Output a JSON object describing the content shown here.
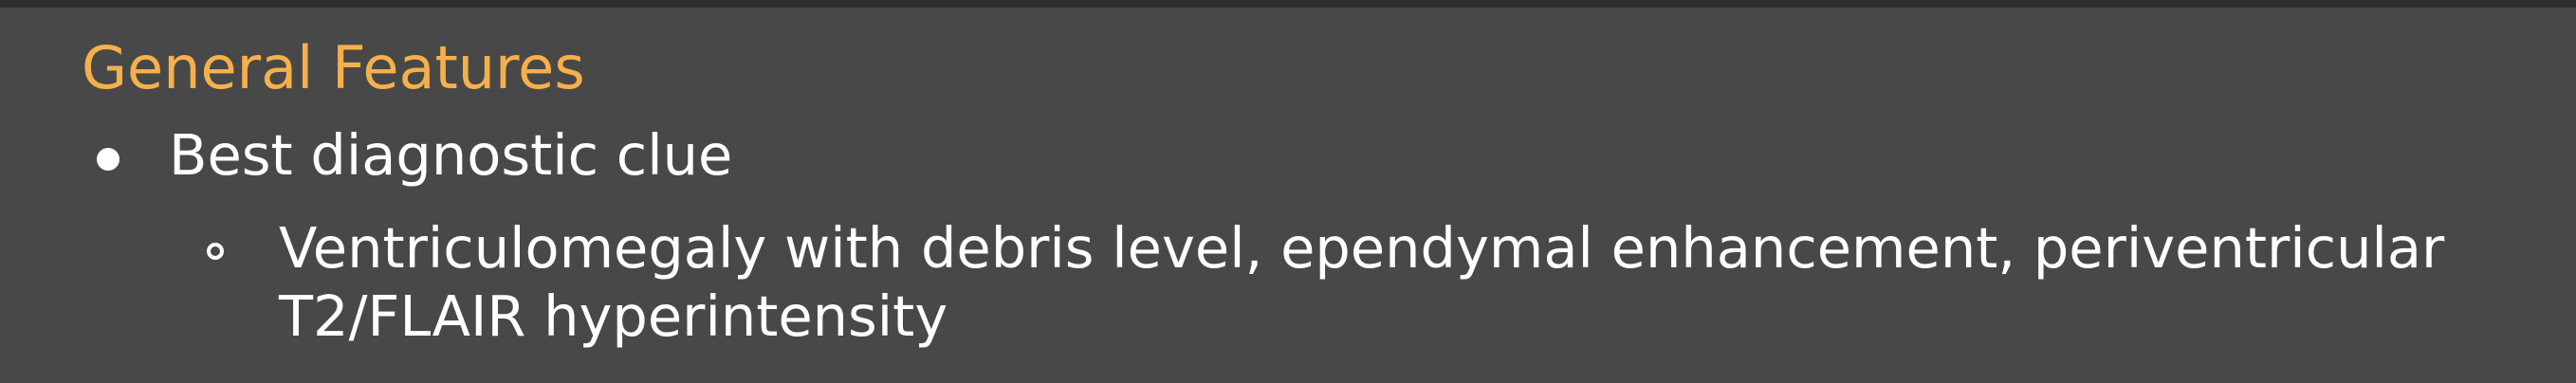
{
  "heading": "General Features",
  "bullets": [
    {
      "text": "Best diagnostic clue",
      "sub": {
        "lines": [
          "Ventriculomegaly with debris level, ependymal enhancement, periventricular",
          "T2/FLAIR hyperintensity"
        ]
      }
    }
  ],
  "colors": {
    "background": "#484848",
    "heading": "#f5b04c",
    "text": "#ffffff",
    "top_strip": "#2e2e2e"
  },
  "icons": {
    "bullet_level_1": "filled-circle-bullet",
    "bullet_level_2": "hollow-circle-bullet"
  }
}
